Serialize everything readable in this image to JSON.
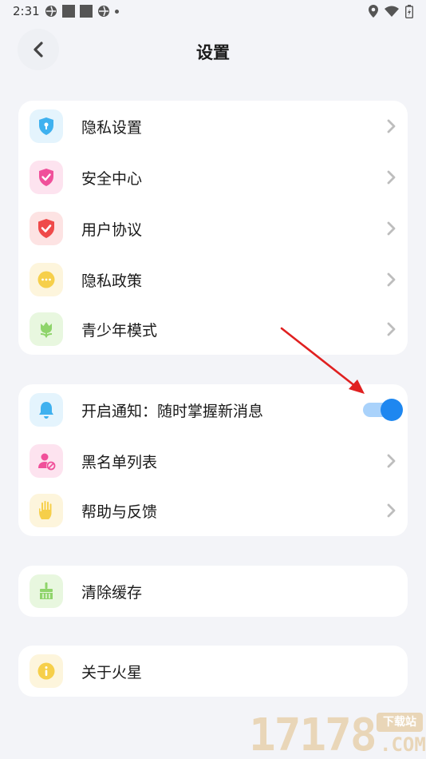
{
  "status_bar": {
    "time": "2:31"
  },
  "header": {
    "title": "设置"
  },
  "group1": {
    "items": [
      {
        "label": "隐私设置",
        "icon": "shield-lock-icon",
        "tile_color": "#e4f4fd",
        "icon_color": "#3fb1ef"
      },
      {
        "label": "安全中心",
        "icon": "shield-check-icon",
        "tile_color": "#fde3ef",
        "icon_color": "#f0509a"
      },
      {
        "label": "用户协议",
        "icon": "shield-check-icon",
        "tile_color": "#fde3e3",
        "icon_color": "#ef4a4a"
      },
      {
        "label": "隐私政策",
        "icon": "chat-bubble-icon",
        "tile_color": "#fdf5dc",
        "icon_color": "#f6cf4a"
      },
      {
        "label": "青少年模式",
        "icon": "tulip-icon",
        "tile_color": "#e8f7df",
        "icon_color": "#8fd46b"
      }
    ]
  },
  "group2": {
    "notify": {
      "label": "开启通知：随时掌握新消息",
      "icon": "bell-icon",
      "enabled": true,
      "tile_color": "#e4f4fd",
      "icon_color": "#3fb1ef"
    },
    "items": [
      {
        "label": "黑名单列表",
        "icon": "user-block-icon",
        "tile_color": "#fde3ef",
        "icon_color": "#f0509a"
      },
      {
        "label": "帮助与反馈",
        "icon": "hand-icon",
        "tile_color": "#fdf5dc",
        "icon_color": "#f6cf4a"
      }
    ]
  },
  "group3": {
    "label": "清除缓存",
    "icon": "broom-icon",
    "tile_color": "#e8f7df",
    "icon_color": "#8fd46b"
  },
  "group4": {
    "label": "关于火星",
    "icon": "info-icon",
    "tile_color": "#fdf5dc",
    "icon_color": "#f6cf4a"
  },
  "colors": {
    "accent": "#1e87f0",
    "arrow": "#e02020",
    "background": "#f3f4f8"
  },
  "watermark": {
    "number": "17178",
    "badge": "下载站",
    "suffix": ".COM"
  }
}
